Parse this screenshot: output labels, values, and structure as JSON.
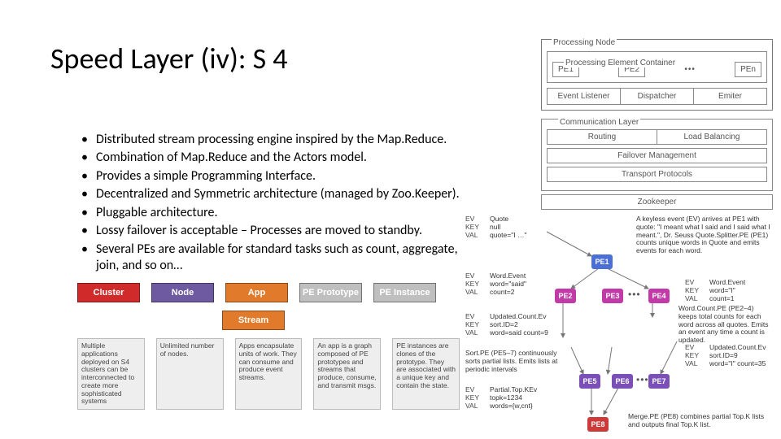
{
  "title": "Speed Layer (iv): S 4",
  "bullets": [
    "Distributed stream processing engine inspired by the Map.Reduce.",
    "Combination of Map.Reduce and the Actors model.",
    "Provides a simple Programming Interface.",
    "Decentralized and Symmetric architecture (managed by Zoo.Keeper).",
    "Pluggable architecture.",
    "Lossy failover is acceptable – Processes are moved to standby.",
    "Several PEs are available for standard tasks such as count, aggregate, join, and so on…"
  ],
  "arch": {
    "node_label": "Processing Node",
    "pec_label": "Processing Element Container",
    "pes": [
      "PE1",
      "PE2",
      "PEn"
    ],
    "row2": [
      "Event Listener",
      "Dispatcher",
      "Emiter"
    ],
    "comm_label": "Communication Layer",
    "comm_row": [
      "Routing",
      "Load Balancing"
    ],
    "failover": "Failover Management",
    "transport": "Transport Protocols",
    "zookeeper": "Zookeeper"
  },
  "blocks": {
    "headers": [
      {
        "label": "Cluster",
        "color": "red",
        "shadow": false
      },
      {
        "label": "Node",
        "color": "purple",
        "shadow": true
      },
      {
        "label": "App",
        "color": "orange",
        "shadow": true
      },
      {
        "label": "PE Prototype",
        "color": "grey",
        "shadow": true
      },
      {
        "label": "PE Instance",
        "color": "grey",
        "shadow": true
      }
    ],
    "stream": {
      "label": "Stream",
      "color": "orange"
    },
    "captions": [
      "Multiple applications deployed on S4 clusters can be interconnected to create more sophisticated systems",
      "Unlimited number of nodes.",
      "Apps encapsulate units of work. They can consume and produce event streams.",
      "An app is a graph composed of PE prototypes and streams that produce, consume, and transmit msgs.",
      "PE instances are clones of the prototype. They are associated with a unique key and contain the state."
    ]
  },
  "flow": {
    "events": [
      {
        "id": "ev0",
        "lines": [
          [
            "EV",
            "Quote"
          ],
          [
            "KEY",
            "null"
          ],
          [
            "VAL",
            "quote=\"I …\""
          ]
        ]
      },
      {
        "id": "ev1",
        "lines": [
          [
            "EV",
            "Word.Event"
          ],
          [
            "KEY",
            "word=\"said\""
          ],
          [
            "VAL",
            "count=2"
          ]
        ]
      },
      {
        "id": "ev2",
        "lines": [
          [
            "EV",
            "Updated.Count.Ev"
          ],
          [
            "KEY",
            "sort.ID=2"
          ],
          [
            "VAL",
            "word=said count=9"
          ]
        ]
      },
      {
        "id": "ev3",
        "lines": [
          [
            "EV",
            "Partial.Top.KEv"
          ],
          [
            "KEY",
            "topk=1234"
          ],
          [
            "VAL",
            "words={w,cnt}"
          ]
        ]
      },
      {
        "id": "ev4",
        "lines": [
          [
            "EV",
            "Word.Event"
          ],
          [
            "KEY",
            "word=\"I\""
          ],
          [
            "VAL",
            "count=1"
          ]
        ]
      },
      {
        "id": "ev5",
        "lines": [
          [
            "EV",
            "Updated.Count.Ev"
          ],
          [
            "KEY",
            "sort.ID=9"
          ],
          [
            "VAL",
            "word=\"I\" count=35"
          ]
        ]
      }
    ],
    "pes": [
      {
        "id": "PE1",
        "color": "blue"
      },
      {
        "id": "PE2",
        "color": "mag"
      },
      {
        "id": "PE3",
        "color": "mag"
      },
      {
        "id": "PE4",
        "color": "mag"
      },
      {
        "id": "PE5",
        "color": "vio"
      },
      {
        "id": "PE6",
        "color": "vio"
      },
      {
        "id": "PE7",
        "color": "vio"
      },
      {
        "id": "PE8",
        "color": "redn"
      }
    ],
    "captions": [
      "A keyless event (EV) arrives at PE1 with quote: \"I meant what I said and I said what I meant.\", Dr. Seuss Quote.Splitter.PE (PE1) counts unique words in Quote and emits events for each word.",
      "Word.Count.PE (PE2–4) keeps total counts for each word across all quotes. Emits an event any time a count is updated.",
      "Sort.PE (PE5–7) continuously sorts partial lists. Emits lists at periodic intervals",
      "Merge.PE (PE8) combines partial Top.K lists and outputs final Top.K list."
    ]
  }
}
